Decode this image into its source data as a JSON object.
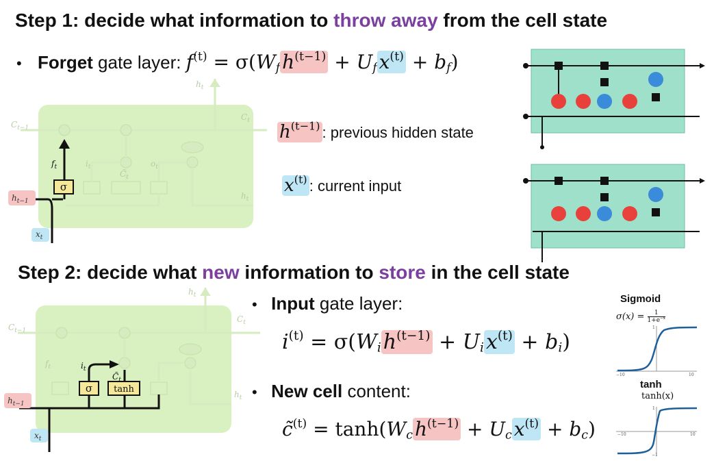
{
  "step1": {
    "prefix": "Step 1: decide what information to ",
    "highlight": "throw away",
    "suffix": " from the cell state"
  },
  "forget": {
    "bullet": "•",
    "bold": "Forget",
    "rest": " gate layer:",
    "f": "f",
    "sup_t": "(t)",
    "eq": " = σ(",
    "W": "W",
    "sub_f": "f",
    "h": "h",
    "sup_t1": "(t−1)",
    "plus1": " + ",
    "U": "U",
    "x": "x",
    "plus2": " + ",
    "b": "b",
    "close": ")"
  },
  "legend": {
    "h": "h",
    "h_sup": "(t−1)",
    "h_text": ": previous hidden state",
    "x": "x",
    "x_sup": "(t)",
    "x_text": ": current input"
  },
  "cell_labels": {
    "c_prev": "C",
    "c_prev_sub": "t−1",
    "c_next": "C",
    "c_next_sub": "t",
    "h_prev": "h",
    "h_prev_sub": "t−1",
    "h_next": "h",
    "h_next_sub": "t",
    "x": "x",
    "x_sub": "t",
    "f": "f",
    "f_sub": "t",
    "i": "i",
    "i_sub": "t",
    "o": "o",
    "o_sub": "t",
    "c_tilde": "C̃",
    "c_tilde_sub": "t",
    "sigma": "σ",
    "tanh": "tanh",
    "times": "×",
    "plus": "+"
  },
  "step2": {
    "prefix": "Step 2: decide what ",
    "hl1": "new",
    "middle": " information to ",
    "hl2": "store",
    "suffix": " in the cell state"
  },
  "input_gate": {
    "bullet": "•",
    "bold": "Input",
    "rest": " gate layer:",
    "i": "i",
    "sup_t": "(t)",
    "eq": " = σ(",
    "W": "W",
    "sub": "i",
    "h": "h",
    "sup_t1": "(t−1)",
    "plus1": " + ",
    "U": "U",
    "x": "x",
    "plus2": " + ",
    "b": "b",
    "close": ")"
  },
  "new_cell": {
    "bullet": "•",
    "bold": "New cell",
    "rest": " content:",
    "c": "c̃",
    "sup_t": "(t)",
    "eq": " = tanh(",
    "W": "W",
    "sub": "c",
    "h": "h",
    "sup_t1": "(t−1)",
    "plus1": " + ",
    "U": "U",
    "x": "x",
    "plus2": " + ",
    "b": "b",
    "close": ")"
  },
  "sigmoid_panel": {
    "title": "Sigmoid",
    "eq_left": "σ(x) = ",
    "num": "1",
    "den": "1+e",
    "den_sup": "−x",
    "y_top": "1",
    "x_left": "−10",
    "x_right": "10"
  },
  "tanh_panel": {
    "title": "tanh",
    "eq": "tanh(x)",
    "y_top": "1",
    "y_bottom": "−1",
    "x_left": "−10",
    "x_right": "10"
  },
  "colors": {
    "purple": "#7b3fa0",
    "cell_green": "#c9e9a6",
    "box_teal": "#9fe0cb",
    "sigma_red": "#e8413c",
    "tanh_blue": "#3a8bd9",
    "hl_red": "#f7c4c4",
    "hl_blue": "#bfe6f5",
    "gate_yellow": "#f5e89a"
  }
}
